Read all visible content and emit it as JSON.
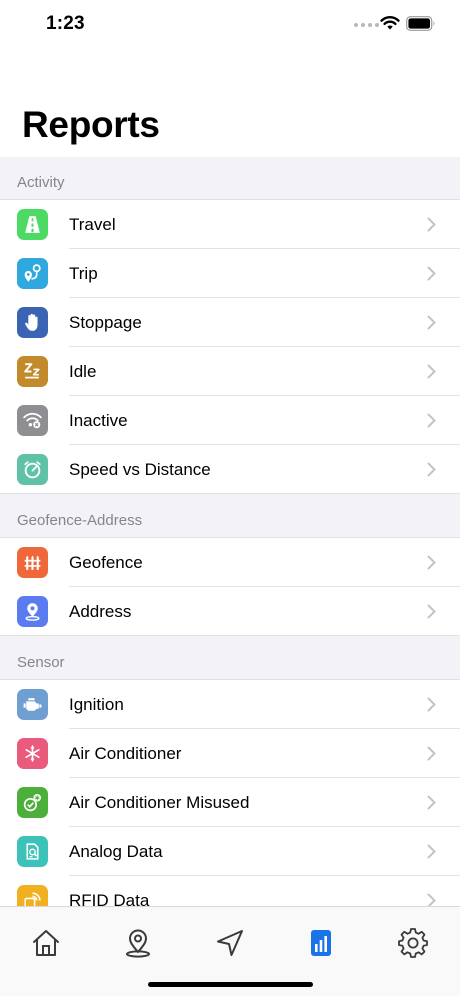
{
  "status_bar": {
    "time": "1:23"
  },
  "page": {
    "title": "Reports"
  },
  "sections": [
    {
      "header": "Activity",
      "items": [
        {
          "label": "Travel",
          "icon": "road-icon",
          "color": "#4cd964"
        },
        {
          "label": "Trip",
          "icon": "route-pin-icon",
          "color": "#2fa8e0"
        },
        {
          "label": "Stoppage",
          "icon": "hand-stop-icon",
          "color": "#3a63b4"
        },
        {
          "label": "Idle",
          "icon": "sleep-zzz-icon",
          "color": "#c28a2b"
        },
        {
          "label": "Inactive",
          "icon": "no-signal-icon",
          "color": "#8e8e93"
        },
        {
          "label": "Speed vs Distance",
          "icon": "speedometer-icon",
          "color": "#5fc2a6"
        }
      ]
    },
    {
      "header": "Geofence-Address",
      "items": [
        {
          "label": "Geofence",
          "icon": "fence-icon",
          "color": "#f0673a"
        },
        {
          "label": "Address",
          "icon": "map-pin-icon",
          "color": "#5b7cf0"
        }
      ]
    },
    {
      "header": "Sensor",
      "items": [
        {
          "label": "Ignition",
          "icon": "engine-icon",
          "color": "#6f9fd0"
        },
        {
          "label": "Air Conditioner",
          "icon": "snowflake-icon",
          "color": "#ea5a7c"
        },
        {
          "label": "Air Conditioner Misused",
          "icon": "ac-misuse-icon",
          "color": "#4caf3a"
        },
        {
          "label": "Analog Data",
          "icon": "analog-icon",
          "color": "#3cc2b8"
        },
        {
          "label": "RFID Data",
          "icon": "rfid-icon",
          "color": "#f0b020"
        }
      ]
    }
  ],
  "tab_bar": {
    "tabs": [
      {
        "icon": "home-icon",
        "active": false
      },
      {
        "icon": "location-icon",
        "active": false
      },
      {
        "icon": "navigation-icon",
        "active": false
      },
      {
        "icon": "reports-icon",
        "active": true
      },
      {
        "icon": "settings-icon",
        "active": false
      }
    ],
    "active_color": "#1a73e8",
    "inactive_color": "#3a3a3c"
  }
}
